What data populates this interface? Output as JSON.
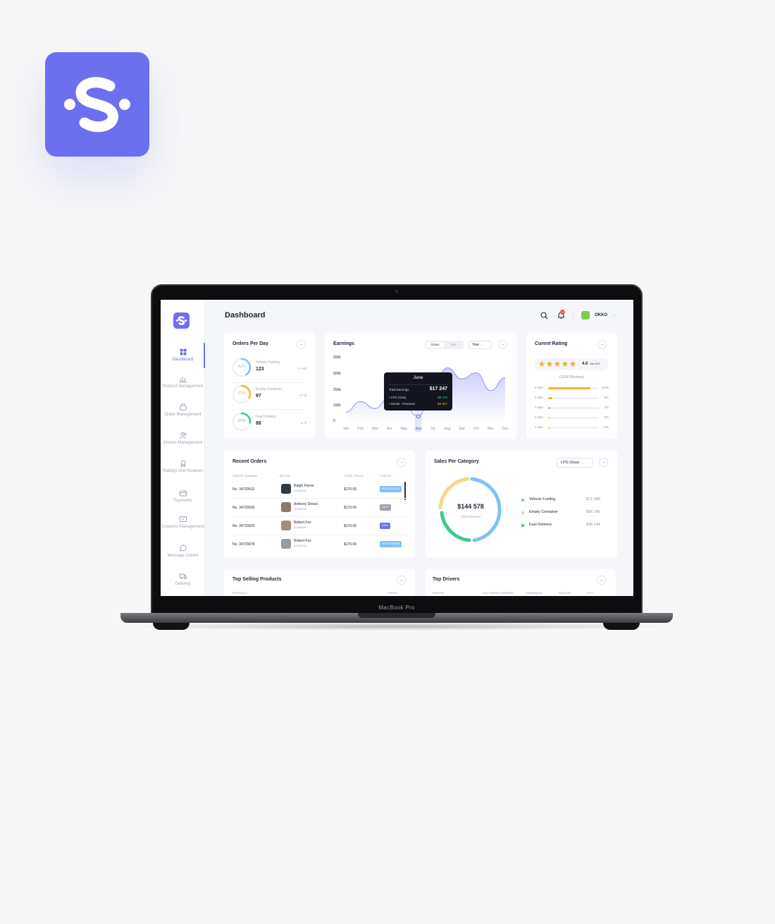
{
  "brand": {
    "accent": "#6c70ef"
  },
  "laptop": {
    "model": "MacBook Pro"
  },
  "header": {
    "title": "Dashboard",
    "notification_count": "13",
    "user": "OKKO"
  },
  "sidebar": {
    "items": [
      {
        "label": "Dashboard",
        "icon": "grid-icon",
        "active": true
      },
      {
        "label": "Product Management",
        "icon": "bar-chart-icon"
      },
      {
        "label": "Order Management",
        "icon": "bag-icon"
      },
      {
        "label": "Drivers Management",
        "icon": "users-icon"
      },
      {
        "label": "Ratings And Reviews",
        "icon": "badge-icon"
      },
      {
        "label": "Payments",
        "icon": "wallet-icon"
      },
      {
        "label": "Coupons Management",
        "icon": "ticket-icon"
      },
      {
        "label": "Message Centre",
        "icon": "chat-icon"
      },
      {
        "label": "Delivery",
        "icon": "truck-icon"
      }
    ]
  },
  "orders_per_day": {
    "title": "Orders Per Day",
    "items": [
      {
        "pct": "41%",
        "pct_value": 0.41,
        "label": "Vehicle Fueling",
        "value": "123",
        "trend": "+12",
        "color": "#7cc3f5",
        "trend_color": "#2cc36b"
      },
      {
        "pct": "32%",
        "pct_value": 0.32,
        "label": "Empty Container",
        "value": "97",
        "trend": "+3",
        "color": "#f4b331",
        "trend_color": "#2cc36b"
      },
      {
        "pct": "27%",
        "pct_value": 0.27,
        "label": "Fuel Delivery",
        "value": "88",
        "trend": "-7",
        "color": "#39cf87",
        "trend_color": "#f0465e"
      }
    ]
  },
  "earnings": {
    "title": "Earnings",
    "toggle": [
      "Gross",
      "Net"
    ],
    "period": "Year",
    "tooltip": {
      "month": "June",
      "total_label": "Total Earnings",
      "total_value": "$17 247",
      "rows": [
        {
          "label": "LPG (Gas)",
          "value": "$6 470",
          "color": "#39cf87"
        },
        {
          "label": "Diesel - Premium",
          "value": "$3 827",
          "color": "#f4b331"
        }
      ]
    }
  },
  "chart_data": {
    "type": "area",
    "x": [
      "Jan",
      "Feb",
      "Mar",
      "Apr",
      "May",
      "Jun",
      "Jul",
      "Aug",
      "Sep",
      "Oct",
      "Nov",
      "Dec"
    ],
    "yticks": [
      "500k",
      "500k",
      "250k",
      "100k",
      "0"
    ],
    "highlight": "Jun",
    "series": [
      {
        "values": [
          42000,
          95000,
          60000,
          115000,
          75000,
          20000,
          155000,
          265000,
          210000,
          240000,
          150000,
          215000
        ]
      }
    ]
  },
  "rating": {
    "title": "Curent Rating",
    "score": "4.0",
    "out_of": "Out Of 5",
    "reviews": "(1200 Review)",
    "rows": [
      {
        "label": "5 Star",
        "pct": "84%",
        "value": 0.84
      },
      {
        "label": "4 Star",
        "pct": "9%",
        "value": 0.09
      },
      {
        "label": "3 Star",
        "pct": "4%",
        "value": 0.04
      },
      {
        "label": "2 Star",
        "pct": "2%",
        "value": 0.02
      },
      {
        "label": "1 Star",
        "pct": "1%",
        "value": 0.01
      }
    ]
  },
  "recent_orders": {
    "title": "Recent Orders",
    "headers": [
      "ORDER NUMBER",
      "BUYER",
      "TOTAL PRICE",
      "STATUS"
    ],
    "rows": [
      {
        "order": "No. 34729912",
        "buyer": "Ralph Flores",
        "id": "#2356266",
        "price": "$170.00",
        "status": "PROCESSING",
        "status_color": "#7cc3f5"
      },
      {
        "order": "No. 34729930",
        "buyer": "Anthony Dirozo",
        "id": "#2356266",
        "price": "$170.00",
        "status": "PAST",
        "status_color": "#9ea2b0"
      },
      {
        "order": "No. 34729933",
        "buyer": "Robert Fox",
        "id": "#2356266",
        "price": "$170.00",
        "status": "NEW",
        "status_color": "#6c70ef"
      },
      {
        "order": "No. 34729978",
        "buyer": "Robert Fox",
        "id": "#2356266",
        "price": "$170.00",
        "status": "PROCESSING",
        "status_color": "#7cc3f5"
      }
    ]
  },
  "sales_per_category": {
    "title": "Sales Per Category",
    "filter": "LPG (Gas)",
    "total": "$144 578",
    "total_label": "Total Revenue",
    "items": [
      {
        "name": "Vehicle Fueling",
        "value": "$72 289",
        "color": "#7cc3f5"
      },
      {
        "name": "Empty Container",
        "value": "$36 145",
        "color": "#fbd48a"
      },
      {
        "name": "Fuel Delivery",
        "value": "$36 144",
        "color": "#39cf87"
      }
    ]
  },
  "top_selling": {
    "title": "Top Selling Products",
    "headers": [
      "PRODUCT",
      "PRICE"
    ]
  },
  "top_drivers": {
    "title": "Top Drivers",
    "headers": [
      "DRIVER",
      "DELIVERED ORDERS",
      "EARNINGS",
      "REGION",
      "CITY"
    ]
  }
}
